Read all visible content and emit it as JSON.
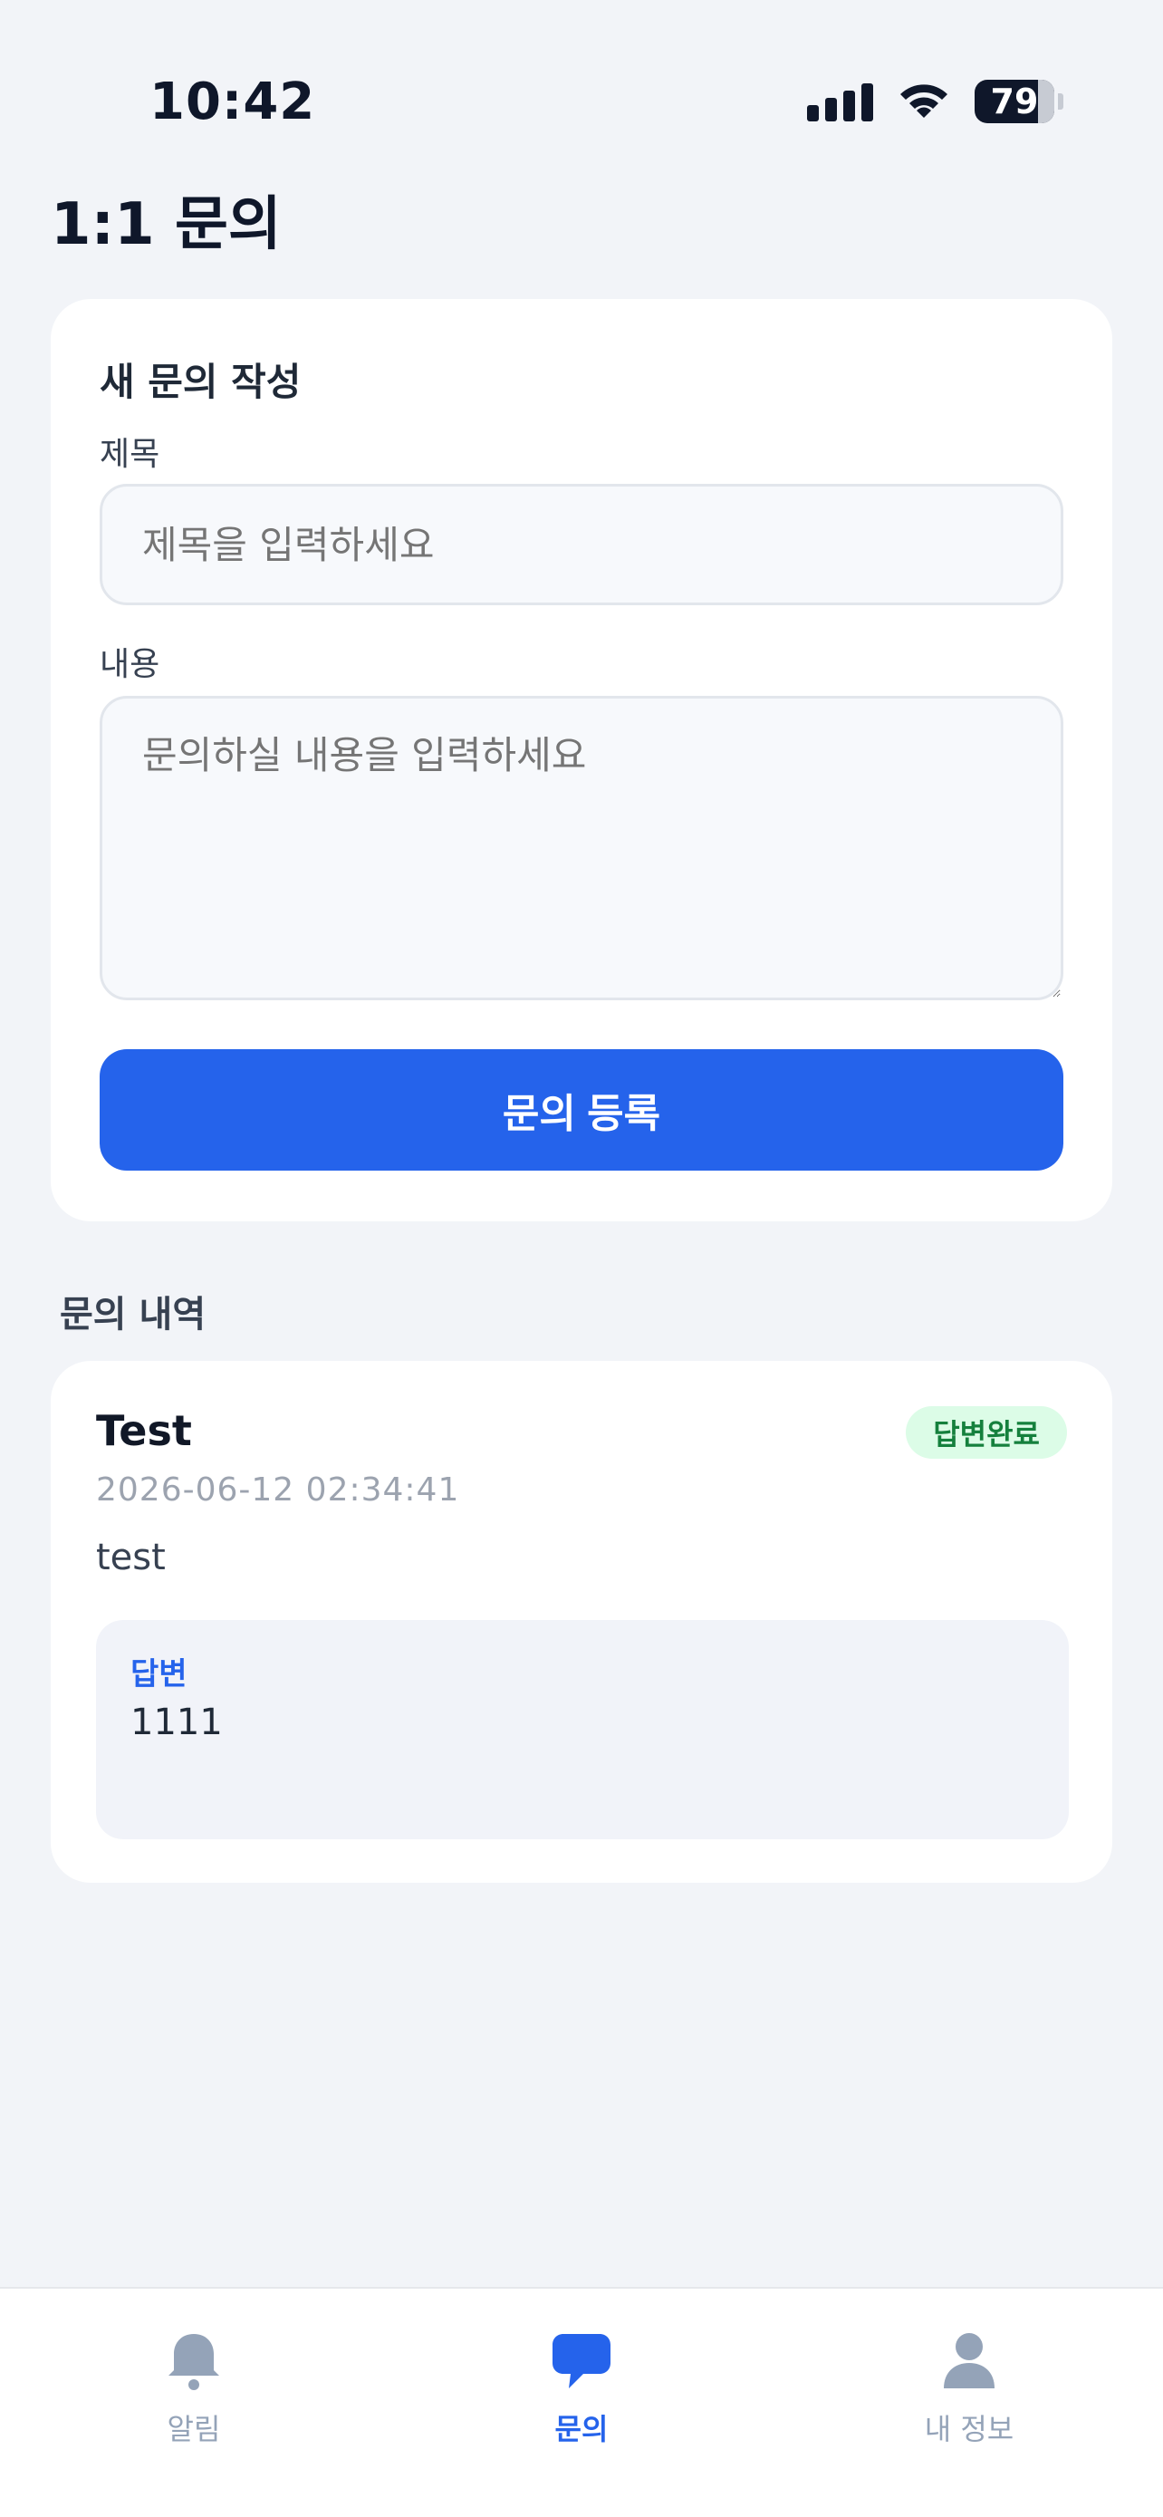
{
  "status_bar": {
    "time": "10:42",
    "battery_level": "79",
    "icons": [
      "signal-icon",
      "wifi-icon",
      "battery-icon"
    ]
  },
  "page": {
    "title": "1:1 문의"
  },
  "form": {
    "heading": "새 문의 작성",
    "title_label": "제목",
    "title_placeholder": "제목을 입력하세요",
    "title_value": "",
    "content_label": "내용",
    "content_placeholder": "문의하실 내용을 입력하세요",
    "content_value": "",
    "submit_label": "문의 등록"
  },
  "history": {
    "heading": "문의 내역",
    "items": [
      {
        "title": "Test",
        "status": "답변완료",
        "date": "2026-06-12 02:34:41",
        "body": "test",
        "answer_label": "답변",
        "answer_text": "1111"
      }
    ]
  },
  "bottom_nav": {
    "items": [
      {
        "label": "알림",
        "icon": "bell-icon",
        "active": false
      },
      {
        "label": "문의",
        "icon": "chat-bubble-icon",
        "active": true
      },
      {
        "label": "내 정보",
        "icon": "person-icon",
        "active": false
      }
    ]
  },
  "colors": {
    "accent": "#2563eb",
    "background": "#f2f4f8",
    "badge_bg": "#dcfce7",
    "badge_text": "#15803d",
    "inactive_nav": "#94a3b8"
  }
}
